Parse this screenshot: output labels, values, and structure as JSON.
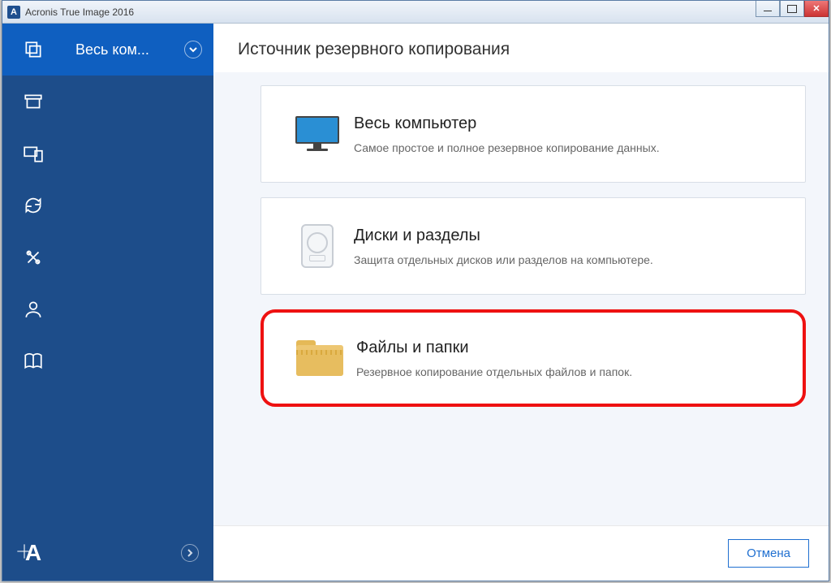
{
  "window": {
    "title": "Acronis True Image 2016",
    "app_icon_letter": "A"
  },
  "sidebar_panel": {
    "header_label": "Весь ком..."
  },
  "main": {
    "heading": "Источник резервного копирования",
    "options": [
      {
        "title": "Весь компьютер",
        "desc": "Самое простое и полное резервное копирование данных."
      },
      {
        "title": "Диски и разделы",
        "desc": "Защита отдельных дисков или разделов на компьютере."
      },
      {
        "title": "Файлы и папки",
        "desc": "Резервное копирование отдельных файлов и папок."
      }
    ],
    "cancel_label": "Отмена"
  },
  "rail": {
    "logo_letter": "A"
  }
}
